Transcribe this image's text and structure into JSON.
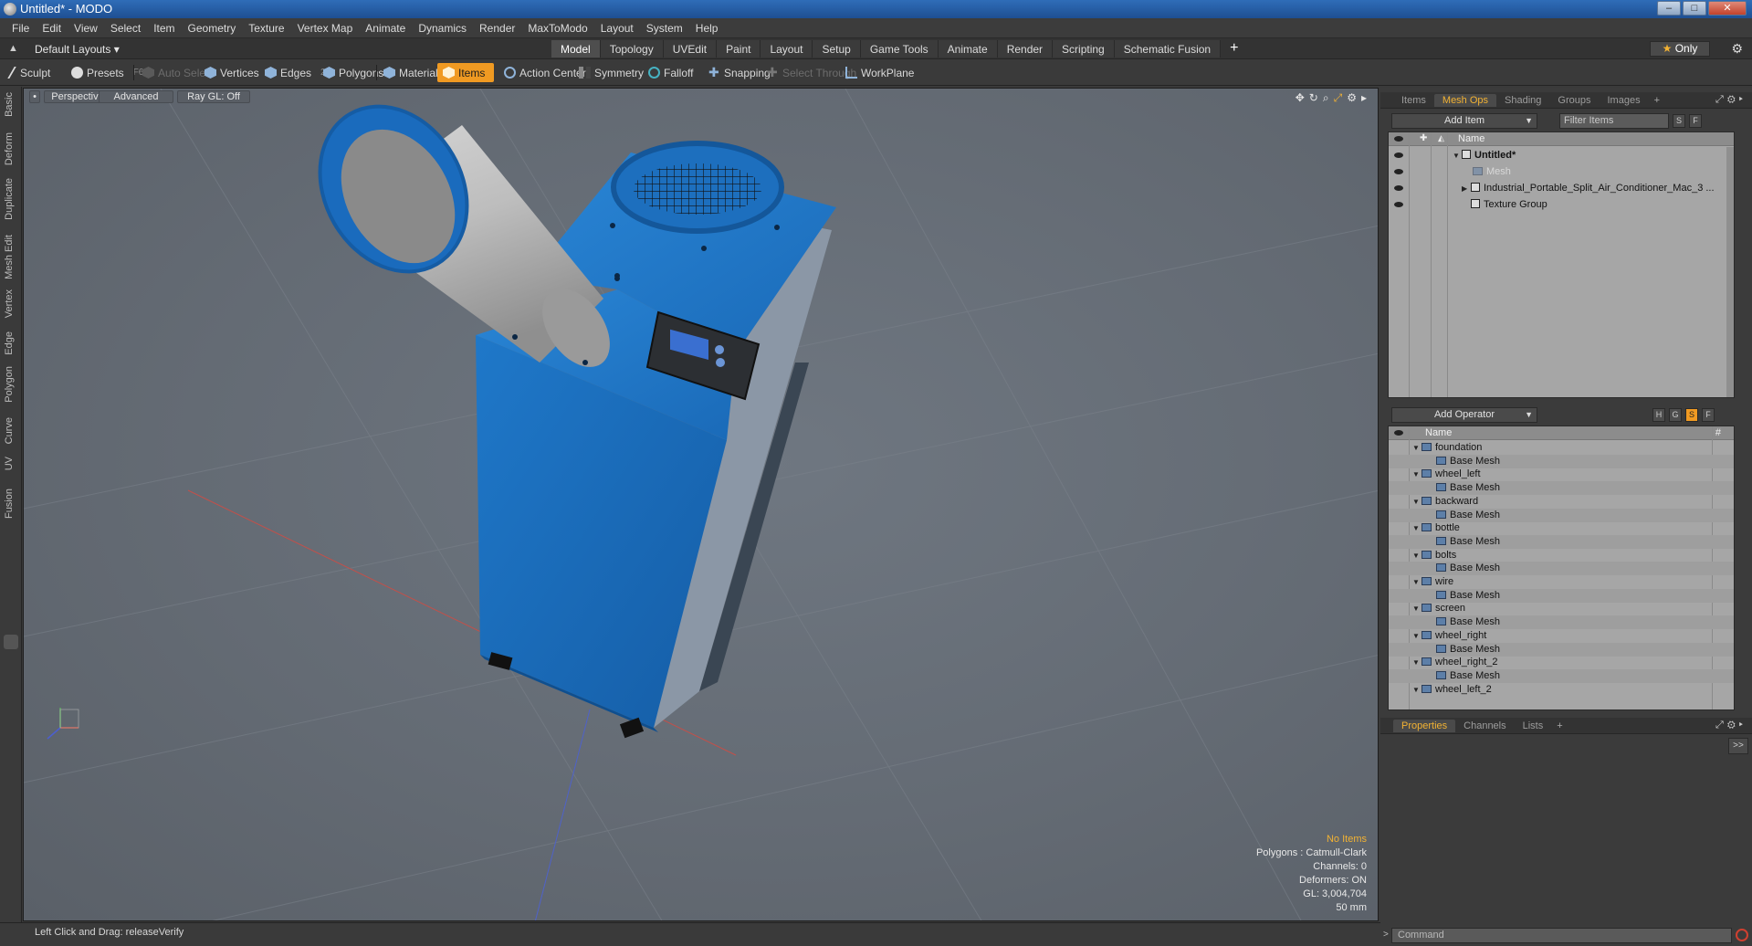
{
  "window": {
    "title": "Untitled* - MODO"
  },
  "menu": [
    "File",
    "Edit",
    "View",
    "Select",
    "Item",
    "Geometry",
    "Texture",
    "Vertex Map",
    "Animate",
    "Dynamics",
    "Render",
    "MaxToModo",
    "Layout",
    "System",
    "Help"
  ],
  "layout_bar": {
    "layout_label": "Default Layouts ▾",
    "tabs": [
      "Model",
      "Topology",
      "UVEdit",
      "Paint",
      "Layout",
      "Setup",
      "Game Tools",
      "Animate",
      "Render",
      "Scripting",
      "Schematic Fusion"
    ],
    "active_tab": "Model",
    "add_tab": "+",
    "only_label": "Only"
  },
  "toolbar": {
    "sculpt": "Sculpt",
    "presets": "Presets",
    "presets_key": "F6",
    "auto_select": "Auto Select",
    "vertices": "Vertices",
    "vertices_num": "1",
    "edges": "Edges",
    "edges_num": "2",
    "polygons": "Polygons",
    "materials": "Materials",
    "items": "Items",
    "action_center": "Action Center",
    "symmetry": "Symmetry",
    "falloff": "Falloff",
    "snapping": "Snapping",
    "select_through": "Select Through",
    "workplane": "WorkPlane"
  },
  "left_tabs": [
    "Basic",
    "Deform",
    "Duplicate",
    "Mesh Edit",
    "Vertex",
    "Edge",
    "Polygon",
    "Curve",
    "UV",
    "Fusion"
  ],
  "viewport": {
    "view": "Perspective",
    "shading": "Advanced",
    "raygl": "Ray GL: Off",
    "info": {
      "selection": "No Items",
      "polygons": "Polygons : Catmull-Clark",
      "channels": "Channels: 0",
      "deformers": "Deformers: ON",
      "gl": "GL: 3,004,704",
      "scale": "50 mm"
    }
  },
  "status": {
    "text": "Left Click and Drag:  releaseVerify"
  },
  "items_panel": {
    "tabs": [
      "Items",
      "Mesh Ops",
      "Shading",
      "Groups",
      "Images"
    ],
    "active_tab": "Mesh Ops",
    "add_tab": "+",
    "add_item": "Add Item",
    "filter_placeholder": "Filter Items",
    "btn_s": "S",
    "btn_f": "F",
    "column_name": "Name",
    "tree": [
      {
        "label": "Untitled*",
        "depth": 0
      },
      {
        "label": "Mesh",
        "depth": 1
      },
      {
        "label": "Industrial_Portable_Split_Air_Conditioner_Mac_3 ...",
        "depth": 1
      },
      {
        "label": "Texture Group",
        "depth": 1
      }
    ]
  },
  "operators_panel": {
    "add_operator": "Add Operator",
    "btn_h": "H",
    "btn_g": "G",
    "btn_s": "S",
    "btn_f": "F",
    "column_name": "Name",
    "column_hash": "#",
    "rows": [
      "foundation",
      "Base Mesh",
      "wheel_left",
      "Base Mesh",
      "backward",
      "Base Mesh",
      "bottle",
      "Base Mesh",
      "bolts",
      "Base Mesh",
      "wire",
      "Base Mesh",
      "screen",
      "Base Mesh",
      "wheel_right",
      "Base Mesh",
      "wheel_right_2",
      "Base Mesh",
      "wheel_left_2"
    ]
  },
  "properties_panel": {
    "tabs": [
      "Properties",
      "Channels",
      "Lists"
    ],
    "active_tab": "Properties",
    "add_tab": "+",
    "expand": ">>",
    "command_placeholder": "Command"
  },
  "colors": {
    "accent": "#f09a22",
    "model_blue": "#1c6ab8",
    "viewport_bg": "#666d75"
  }
}
